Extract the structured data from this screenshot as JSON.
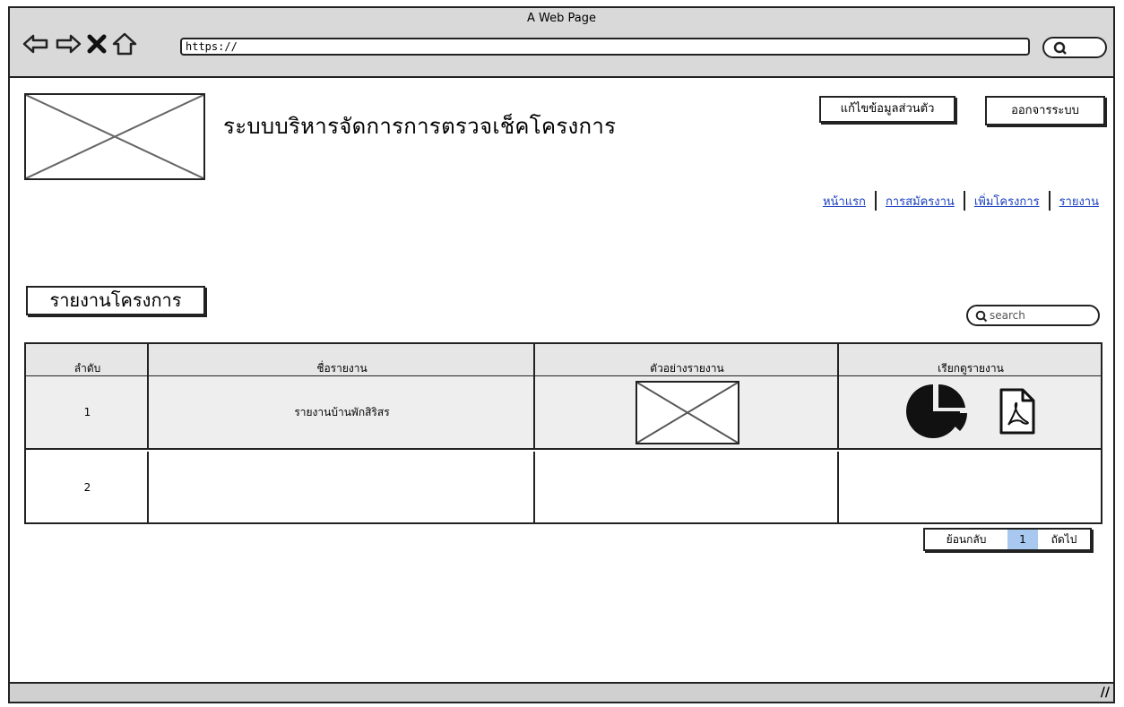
{
  "browser": {
    "title": "A Web Page",
    "url": "https://"
  },
  "header": {
    "app_title": "ระบบบริหารจัดการการตรวจเช็คโครงการ",
    "edit_profile_label": "แก้ไขข้อมูลส่วนตัว",
    "logout_label": "ออกจารระบบ"
  },
  "nav": {
    "items": [
      {
        "label": "หน้าแรก"
      },
      {
        "label": "การสมัครงาน"
      },
      {
        "label": "เพิ่มโครงการ"
      },
      {
        "label": "รายงาน"
      }
    ]
  },
  "section": {
    "title": "รายงานโครงการ",
    "search_placeholder": "search"
  },
  "table": {
    "headers": [
      "ลำดับ",
      "ชื่อรายงาน",
      "ตัวอย่างรายงาน",
      "เรียกดูรายงาน"
    ],
    "rows": [
      {
        "no": "1",
        "name": "รายงานบ้านพักสิริสร"
      },
      {
        "no": "2",
        "name": ""
      }
    ]
  },
  "pagination": {
    "prev_label": "ย้อนกลับ",
    "current_page": "1",
    "next_label": "ถัดไป"
  },
  "icons": {
    "back": "left-arrow-icon",
    "forward": "right-arrow-icon",
    "stop": "close-icon",
    "home": "home-icon",
    "search": "search-icon",
    "chart": "pie-chart-icon",
    "pdf": "pdf-icon"
  },
  "colors": {
    "chrome": "#d9d9d9",
    "link": "#1a3fbf",
    "active_page": "#a8c8f0"
  }
}
